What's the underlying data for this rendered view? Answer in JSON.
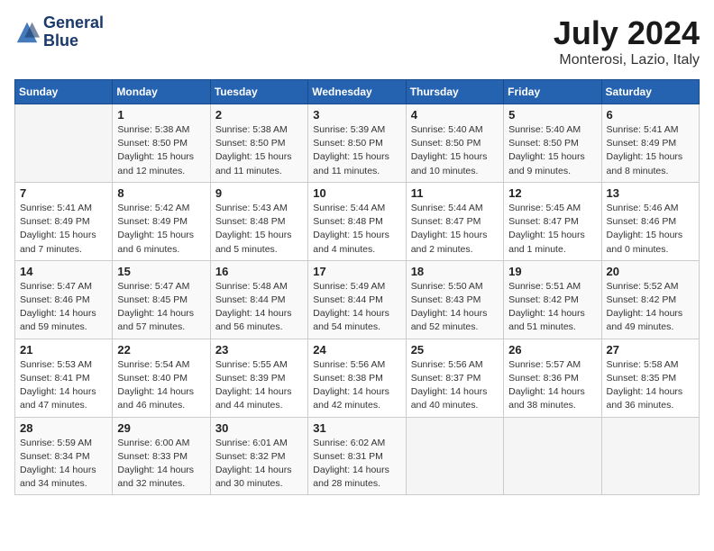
{
  "logo": {
    "line1": "General",
    "line2": "Blue"
  },
  "title": "July 2024",
  "location": "Monterosi, Lazio, Italy",
  "headers": [
    "Sunday",
    "Monday",
    "Tuesday",
    "Wednesday",
    "Thursday",
    "Friday",
    "Saturday"
  ],
  "weeks": [
    [
      {
        "day": "",
        "info": ""
      },
      {
        "day": "1",
        "info": "Sunrise: 5:38 AM\nSunset: 8:50 PM\nDaylight: 15 hours\nand 12 minutes."
      },
      {
        "day": "2",
        "info": "Sunrise: 5:38 AM\nSunset: 8:50 PM\nDaylight: 15 hours\nand 11 minutes."
      },
      {
        "day": "3",
        "info": "Sunrise: 5:39 AM\nSunset: 8:50 PM\nDaylight: 15 hours\nand 11 minutes."
      },
      {
        "day": "4",
        "info": "Sunrise: 5:40 AM\nSunset: 8:50 PM\nDaylight: 15 hours\nand 10 minutes."
      },
      {
        "day": "5",
        "info": "Sunrise: 5:40 AM\nSunset: 8:50 PM\nDaylight: 15 hours\nand 9 minutes."
      },
      {
        "day": "6",
        "info": "Sunrise: 5:41 AM\nSunset: 8:49 PM\nDaylight: 15 hours\nand 8 minutes."
      }
    ],
    [
      {
        "day": "7",
        "info": "Sunrise: 5:41 AM\nSunset: 8:49 PM\nDaylight: 15 hours\nand 7 minutes."
      },
      {
        "day": "8",
        "info": "Sunrise: 5:42 AM\nSunset: 8:49 PM\nDaylight: 15 hours\nand 6 minutes."
      },
      {
        "day": "9",
        "info": "Sunrise: 5:43 AM\nSunset: 8:48 PM\nDaylight: 15 hours\nand 5 minutes."
      },
      {
        "day": "10",
        "info": "Sunrise: 5:44 AM\nSunset: 8:48 PM\nDaylight: 15 hours\nand 4 minutes."
      },
      {
        "day": "11",
        "info": "Sunrise: 5:44 AM\nSunset: 8:47 PM\nDaylight: 15 hours\nand 2 minutes."
      },
      {
        "day": "12",
        "info": "Sunrise: 5:45 AM\nSunset: 8:47 PM\nDaylight: 15 hours\nand 1 minute."
      },
      {
        "day": "13",
        "info": "Sunrise: 5:46 AM\nSunset: 8:46 PM\nDaylight: 15 hours\nand 0 minutes."
      }
    ],
    [
      {
        "day": "14",
        "info": "Sunrise: 5:47 AM\nSunset: 8:46 PM\nDaylight: 14 hours\nand 59 minutes."
      },
      {
        "day": "15",
        "info": "Sunrise: 5:47 AM\nSunset: 8:45 PM\nDaylight: 14 hours\nand 57 minutes."
      },
      {
        "day": "16",
        "info": "Sunrise: 5:48 AM\nSunset: 8:44 PM\nDaylight: 14 hours\nand 56 minutes."
      },
      {
        "day": "17",
        "info": "Sunrise: 5:49 AM\nSunset: 8:44 PM\nDaylight: 14 hours\nand 54 minutes."
      },
      {
        "day": "18",
        "info": "Sunrise: 5:50 AM\nSunset: 8:43 PM\nDaylight: 14 hours\nand 52 minutes."
      },
      {
        "day": "19",
        "info": "Sunrise: 5:51 AM\nSunset: 8:42 PM\nDaylight: 14 hours\nand 51 minutes."
      },
      {
        "day": "20",
        "info": "Sunrise: 5:52 AM\nSunset: 8:42 PM\nDaylight: 14 hours\nand 49 minutes."
      }
    ],
    [
      {
        "day": "21",
        "info": "Sunrise: 5:53 AM\nSunset: 8:41 PM\nDaylight: 14 hours\nand 47 minutes."
      },
      {
        "day": "22",
        "info": "Sunrise: 5:54 AM\nSunset: 8:40 PM\nDaylight: 14 hours\nand 46 minutes."
      },
      {
        "day": "23",
        "info": "Sunrise: 5:55 AM\nSunset: 8:39 PM\nDaylight: 14 hours\nand 44 minutes."
      },
      {
        "day": "24",
        "info": "Sunrise: 5:56 AM\nSunset: 8:38 PM\nDaylight: 14 hours\nand 42 minutes."
      },
      {
        "day": "25",
        "info": "Sunrise: 5:56 AM\nSunset: 8:37 PM\nDaylight: 14 hours\nand 40 minutes."
      },
      {
        "day": "26",
        "info": "Sunrise: 5:57 AM\nSunset: 8:36 PM\nDaylight: 14 hours\nand 38 minutes."
      },
      {
        "day": "27",
        "info": "Sunrise: 5:58 AM\nSunset: 8:35 PM\nDaylight: 14 hours\nand 36 minutes."
      }
    ],
    [
      {
        "day": "28",
        "info": "Sunrise: 5:59 AM\nSunset: 8:34 PM\nDaylight: 14 hours\nand 34 minutes."
      },
      {
        "day": "29",
        "info": "Sunrise: 6:00 AM\nSunset: 8:33 PM\nDaylight: 14 hours\nand 32 minutes."
      },
      {
        "day": "30",
        "info": "Sunrise: 6:01 AM\nSunset: 8:32 PM\nDaylight: 14 hours\nand 30 minutes."
      },
      {
        "day": "31",
        "info": "Sunrise: 6:02 AM\nSunset: 8:31 PM\nDaylight: 14 hours\nand 28 minutes."
      },
      {
        "day": "",
        "info": ""
      },
      {
        "day": "",
        "info": ""
      },
      {
        "day": "",
        "info": ""
      }
    ]
  ]
}
